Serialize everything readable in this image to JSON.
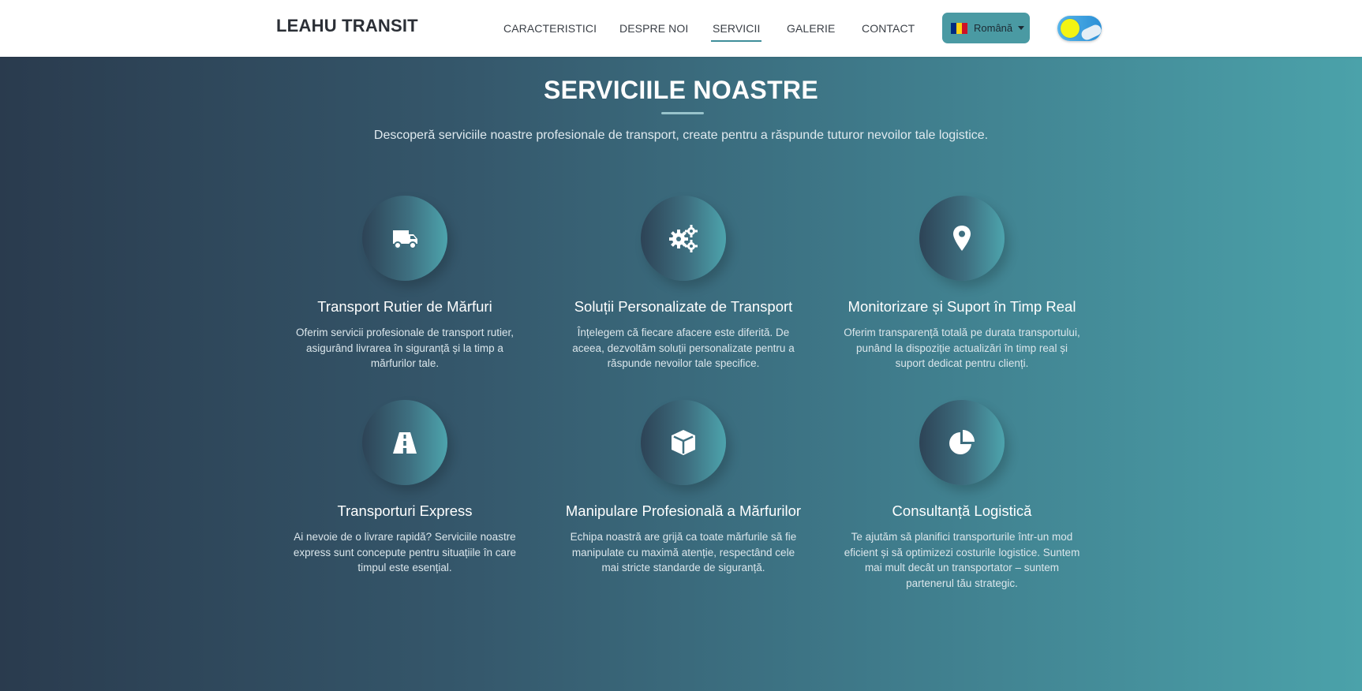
{
  "brand": "LEAHU TRANSIT",
  "nav": {
    "items": [
      "CARACTERISTICI",
      "DESPRE NOI",
      "SERVICII",
      "GALERIE",
      "CONTACT"
    ],
    "active": "SERVICII"
  },
  "language": {
    "label": "Română",
    "flag": "romania-flag-icon",
    "flag_colors": [
      "#002b7f",
      "#fcd116",
      "#ce1126"
    ]
  },
  "theme_toggle": {
    "state": "light",
    "icon": "sun-icon"
  },
  "services": {
    "title": "SERVICIILE NOASTRE",
    "subtitle": "Descoperă serviciile noastre profesionale de transport, create pentru a răspunde tuturor nevoilor tale logistice.",
    "items": [
      {
        "icon": "truck-icon",
        "title": "Transport Rutier de Mărfuri",
        "text": "Oferim servicii profesionale de transport rutier, asigurând livrarea în siguranță și la timp a mărfurilor tale."
      },
      {
        "icon": "gears-icon",
        "title": "Soluții Personalizate de Transport",
        "text": "Înțelegem că fiecare afacere este diferită. De aceea, dezvoltăm soluții personalizate pentru a răspunde nevoilor tale specifice."
      },
      {
        "icon": "map-marker-icon",
        "title": "Monitorizare și Suport în Timp Real",
        "text": "Oferim transparență totală pe durata transportului, punând la dispoziție actualizări în timp real și suport dedicat pentru clienți."
      },
      {
        "icon": "road-icon",
        "title": "Transporturi Express",
        "text": "Ai nevoie de o livrare rapidă? Serviciile noastre express sunt concepute pentru situațiile în care timpul este esențial."
      },
      {
        "icon": "box-icon",
        "title": "Manipulare Profesională a Mărfurilor",
        "text": "Echipa noastră are grijă ca toate mărfurile să fie manipulate cu maximă atenție, respectând cele mai stricte standarde de siguranță."
      },
      {
        "icon": "pie-chart-icon",
        "title": "Consultanță Logistică",
        "text": "Te ajutăm să planifici transporturile într-un mod eficient și să optimizezi costurile logistice. Suntem mai mult decât un transportator – suntem partenerul tău strategic."
      }
    ]
  },
  "colors": {
    "accent": "#4a9aa3",
    "gradient_start": "#2a3b4e",
    "gradient_end": "#4ba2aa"
  }
}
